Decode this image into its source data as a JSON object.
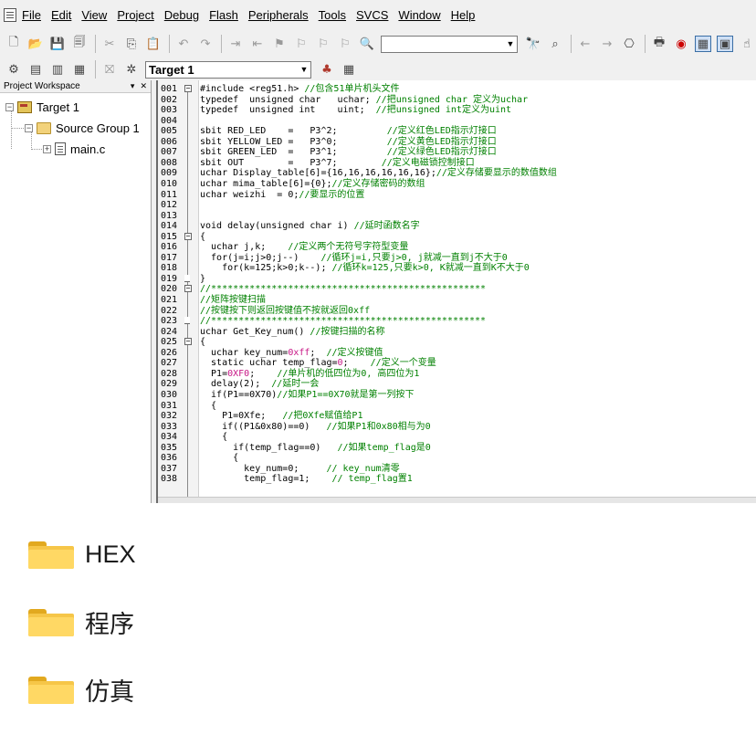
{
  "menu": [
    "File",
    "Edit",
    "View",
    "Project",
    "Debug",
    "Flash",
    "Peripherals",
    "Tools",
    "SVCS",
    "Window",
    "Help"
  ],
  "toolbar": {
    "target_select": "Target 1"
  },
  "workspace": {
    "title": "Project Workspace",
    "target": "Target 1",
    "group": "Source Group 1",
    "file": "main.c"
  },
  "code_lines": [
    {
      "n": "001",
      "fold": "minus",
      "t": [
        [
          "#include <reg51.h> ",
          ""
        ],
        [
          "//包含51单片机头文件",
          "cm"
        ]
      ]
    },
    {
      "n": "002",
      "t": [
        [
          "typedef  unsigned char   uchar; ",
          ""
        ],
        [
          "//把unsigned char 定义为uchar",
          "cm"
        ]
      ]
    },
    {
      "n": "003",
      "t": [
        [
          "typedef  unsigned int    uint;  ",
          ""
        ],
        [
          "//把unsigned int定义为uint",
          "cm"
        ]
      ]
    },
    {
      "n": "004",
      "t": [
        [
          "",
          ""
        ]
      ]
    },
    {
      "n": "005",
      "t": [
        [
          "sbit RED_LED    =   P3^2;         ",
          ""
        ],
        [
          "//定义红色LED指示灯接口",
          "cm"
        ]
      ]
    },
    {
      "n": "006",
      "t": [
        [
          "sbit YELLOW_LED =   P3^0;         ",
          ""
        ],
        [
          "//定义黄色LED指示灯接口",
          "cm"
        ]
      ]
    },
    {
      "n": "007",
      "t": [
        [
          "sbit GREEN_LED  =   P3^1;         ",
          ""
        ],
        [
          "//定义绿色LED指示灯接口",
          "cm"
        ]
      ]
    },
    {
      "n": "008",
      "t": [
        [
          "sbit OUT        =   P3^7;        ",
          ""
        ],
        [
          "//定义电磁锁控制接口",
          "cm"
        ]
      ]
    },
    {
      "n": "009",
      "t": [
        [
          "uchar Display_table[6]={16,16,16,16,16,16};",
          ""
        ],
        [
          "//定义存储要显示的数值数组",
          "cm"
        ]
      ]
    },
    {
      "n": "010",
      "t": [
        [
          "uchar mima_table[6]={0};",
          ""
        ],
        [
          "//定义存储密码的数组",
          "cm"
        ]
      ]
    },
    {
      "n": "011",
      "t": [
        [
          "uchar weizhi  = 0;",
          ""
        ],
        [
          "//要显示的位置",
          "cm"
        ]
      ]
    },
    {
      "n": "012",
      "t": [
        [
          "",
          ""
        ]
      ]
    },
    {
      "n": "013",
      "t": [
        [
          "",
          ""
        ]
      ]
    },
    {
      "n": "014",
      "t": [
        [
          "void delay(unsigned char i) ",
          ""
        ],
        [
          "//延时函数名字",
          "cm"
        ]
      ]
    },
    {
      "n": "015",
      "fold": "minus",
      "t": [
        [
          "{",
          ""
        ]
      ]
    },
    {
      "n": "016",
      "t": [
        [
          "  uchar j,k;    ",
          ""
        ],
        [
          "//定义两个无符号字符型变量",
          "cm"
        ]
      ]
    },
    {
      "n": "017",
      "t": [
        [
          "  for(j=i;j>0;j--)    ",
          ""
        ],
        [
          "//循环j=i,只要j>0, j就减一直到j不大于0",
          "cm"
        ]
      ]
    },
    {
      "n": "018",
      "t": [
        [
          "    for(k=125;k>0;k--); ",
          ""
        ],
        [
          "//循环k=125,只要k>0, K就减一直到K不大于0",
          "cm"
        ]
      ]
    },
    {
      "n": "019",
      "fold": "end",
      "t": [
        [
          "}",
          ""
        ]
      ]
    },
    {
      "n": "020",
      "fold": "minus",
      "t": [
        [
          "//**************************************************",
          "cm"
        ]
      ]
    },
    {
      "n": "021",
      "t": [
        [
          "//矩阵按键扫描",
          "cm"
        ]
      ]
    },
    {
      "n": "022",
      "t": [
        [
          "//按键按下则返回按键值不按就返回0xff",
          "cm"
        ]
      ]
    },
    {
      "n": "023",
      "fold": "end",
      "t": [
        [
          "//**************************************************",
          "cm"
        ]
      ]
    },
    {
      "n": "024",
      "t": [
        [
          "uchar Get_Key_num() ",
          ""
        ],
        [
          "//按键扫描的名称",
          "cm"
        ]
      ]
    },
    {
      "n": "025",
      "fold": "minus",
      "t": [
        [
          "{",
          ""
        ]
      ]
    },
    {
      "n": "026",
      "t": [
        [
          "  uchar key_num=",
          ""
        ],
        [
          "0xff",
          "num"
        ],
        [
          ";  ",
          ""
        ],
        [
          "//定义按键值",
          "cm"
        ]
      ]
    },
    {
      "n": "027",
      "t": [
        [
          "  static uchar temp_flag=",
          ""
        ],
        [
          "0",
          "num"
        ],
        [
          ";    ",
          ""
        ],
        [
          "//定义一个变量",
          "cm"
        ]
      ]
    },
    {
      "n": "028",
      "t": [
        [
          "  P1=",
          ""
        ],
        [
          "0XF0",
          "num"
        ],
        [
          ";    ",
          ""
        ],
        [
          "//单片机的低四位为0, 高四位为1",
          "cm"
        ]
      ]
    },
    {
      "n": "029",
      "t": [
        [
          "  delay(2);  ",
          ""
        ],
        [
          "//延时一会",
          "cm"
        ]
      ]
    },
    {
      "n": "030",
      "t": [
        [
          "  if(P1==0X70)",
          ""
        ],
        [
          "//如果P1==0X70就是第一列按下",
          "cm"
        ]
      ]
    },
    {
      "n": "031",
      "t": [
        [
          "  {",
          ""
        ]
      ]
    },
    {
      "n": "032",
      "t": [
        [
          "    P1=0Xfe;   ",
          ""
        ],
        [
          "//把0Xfe赋值给P1",
          "cm"
        ]
      ]
    },
    {
      "n": "033",
      "t": [
        [
          "    if((P1&0x80)==0)   ",
          ""
        ],
        [
          "//如果P1和0x80相与为0",
          "cm"
        ]
      ]
    },
    {
      "n": "034",
      "t": [
        [
          "    {",
          ""
        ]
      ]
    },
    {
      "n": "035",
      "t": [
        [
          "      if(temp_flag==0)   ",
          ""
        ],
        [
          "//如果temp_flag是0",
          "cm"
        ]
      ]
    },
    {
      "n": "036",
      "t": [
        [
          "      {",
          ""
        ]
      ]
    },
    {
      "n": "037",
      "t": [
        [
          "        key_num=0;     ",
          ""
        ],
        [
          "// key_num清零",
          "cm"
        ]
      ]
    },
    {
      "n": "038",
      "t": [
        [
          "        temp_flag=1;    ",
          ""
        ],
        [
          "// temp_flag置1",
          "cm"
        ]
      ]
    }
  ],
  "folders": [
    {
      "name": "HEX"
    },
    {
      "name": "程序"
    },
    {
      "name": "仿真"
    }
  ]
}
